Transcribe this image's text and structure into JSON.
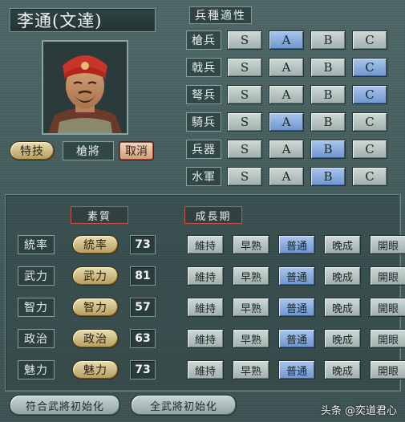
{
  "general": {
    "name": "李通(文達)"
  },
  "aptitude": {
    "title": "兵種適性",
    "grades": [
      "S",
      "A",
      "B",
      "C"
    ],
    "rows": [
      {
        "label": "槍兵",
        "selected": "A"
      },
      {
        "label": "戟兵",
        "selected": "C"
      },
      {
        "label": "弩兵",
        "selected": "C"
      },
      {
        "label": "騎兵",
        "selected": "A"
      },
      {
        "label": "兵器",
        "selected": "B"
      },
      {
        "label": "水軍",
        "selected": "B"
      }
    ]
  },
  "skill": {
    "button_label": "特技",
    "value": "槍將",
    "cancel_label": "取消"
  },
  "stats": {
    "header_quality": "素質",
    "header_growth": "成長期",
    "growth_options": [
      "維持",
      "早熟",
      "普通",
      "晚成",
      "開眼"
    ],
    "rows": [
      {
        "label": "統率",
        "button": "統率",
        "value": "73",
        "growth": "普通"
      },
      {
        "label": "武力",
        "button": "武力",
        "value": "81",
        "growth": "普通"
      },
      {
        "label": "智力",
        "button": "智力",
        "value": "57",
        "growth": "普通"
      },
      {
        "label": "政治",
        "button": "政治",
        "value": "63",
        "growth": "普通"
      },
      {
        "label": "魅力",
        "button": "魅力",
        "value": "73",
        "growth": "普通"
      }
    ]
  },
  "footer": {
    "reset_matching": "符合武將初始化",
    "reset_all": "全武將初始化"
  },
  "watermark": "头条 @奕道君心",
  "colors": {
    "selected": "#7ea4d8",
    "normal": "#b8c7c4",
    "accent_red": "#c85248"
  }
}
